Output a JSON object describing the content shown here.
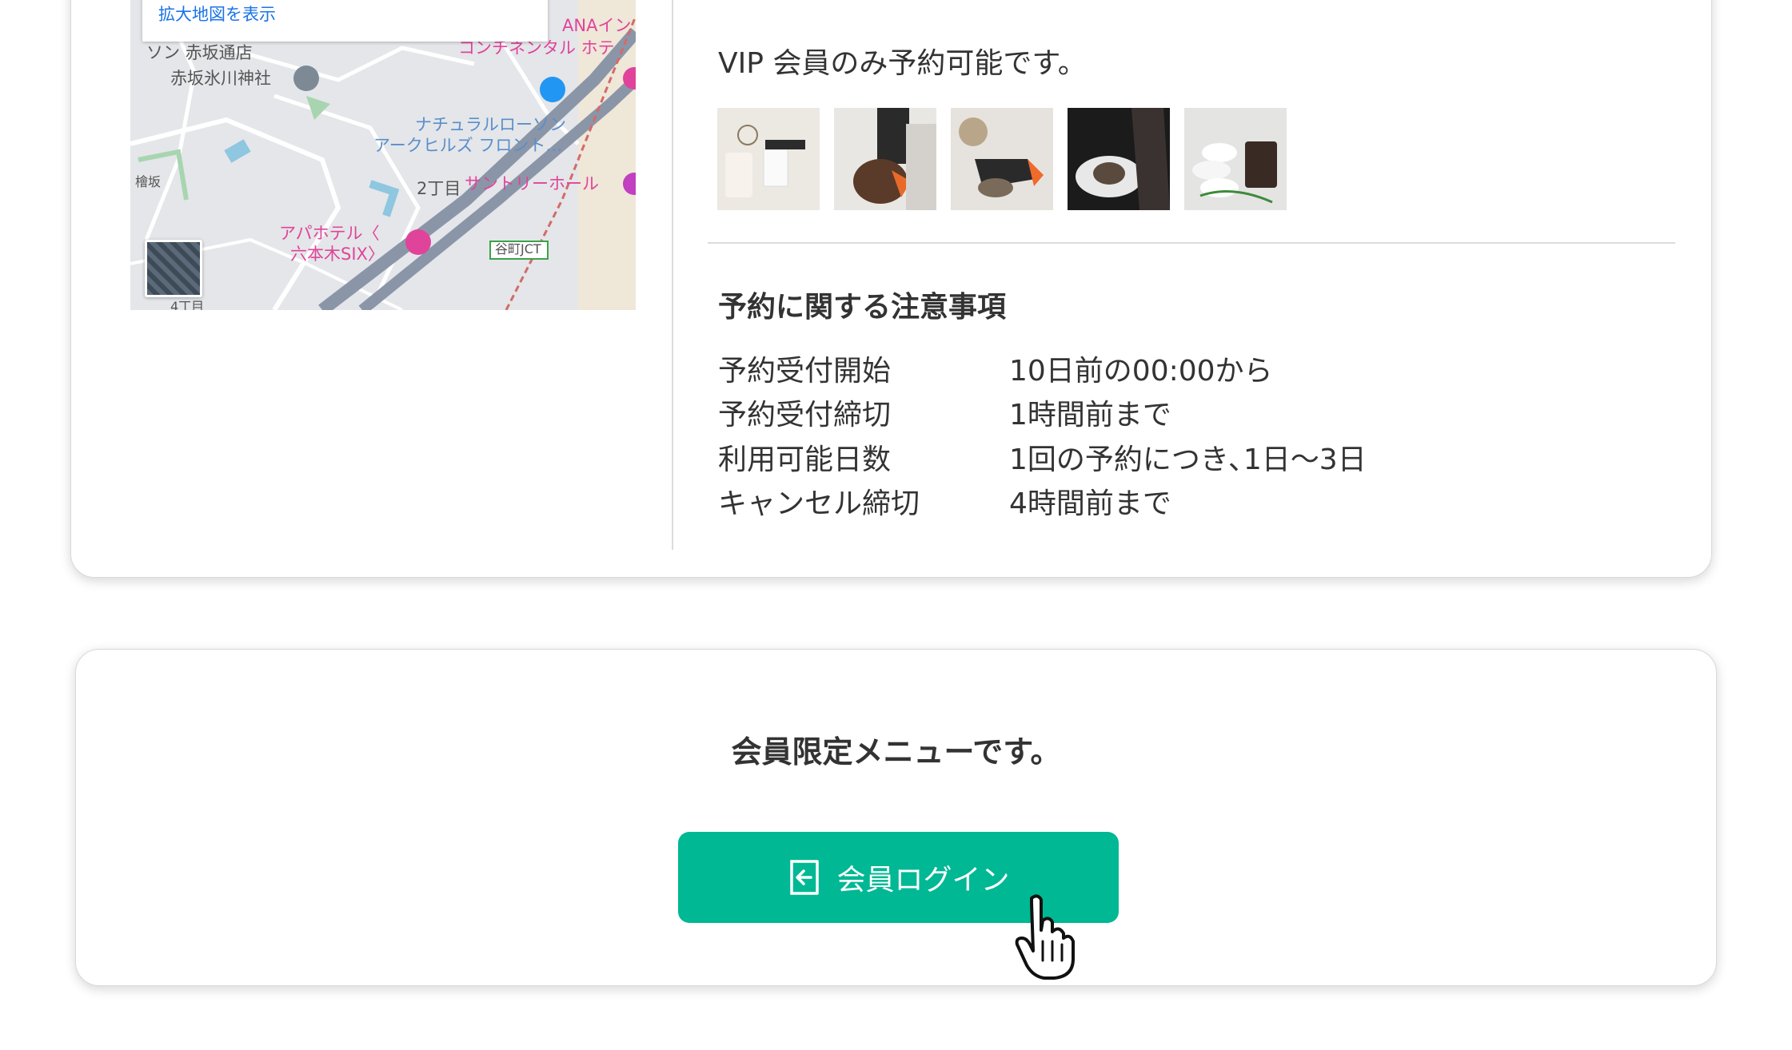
{
  "map": {
    "link_label": "拡大地図を表示",
    "zoom_in": "+",
    "zoom_out": "−",
    "labels": [
      "ソン 赤坂通店",
      "赤坂氷川神社",
      "ANAイン",
      "コンチネンタル ホテ",
      "ナチュラルローソン",
      "アークヒルズ フロント…",
      "2丁目",
      "サントリーホール",
      "アパホテル〈",
      "六本木SIX〉",
      "谷町JCT",
      "檜坂",
      "4丁目"
    ]
  },
  "reservation": {
    "vip_text": "VIP 会員のみ予約可能です。",
    "photos": [
      "salon-products-photo",
      "hair-drying-photo",
      "hair-dryer-photo",
      "shampoo-photo",
      "towels-candle-photo"
    ],
    "notes_title": "予約に関する注意事項",
    "notes": [
      {
        "label": "予約受付開始",
        "value": "10日前の00:00から"
      },
      {
        "label": "予約受付締切",
        "value": "1時間前まで"
      },
      {
        "label": "利用可能日数",
        "value": "1回の予約につき､1日〜3日"
      },
      {
        "label": "キャンセル締切",
        "value": "4時間前まで"
      }
    ]
  },
  "members": {
    "message": "会員限定メニューです。",
    "login_label": "会員ログイン",
    "login_icon": "login-arrow-icon"
  },
  "colors": {
    "accent": "#00b894",
    "map_link": "#1a73e8",
    "text": "#333333"
  }
}
